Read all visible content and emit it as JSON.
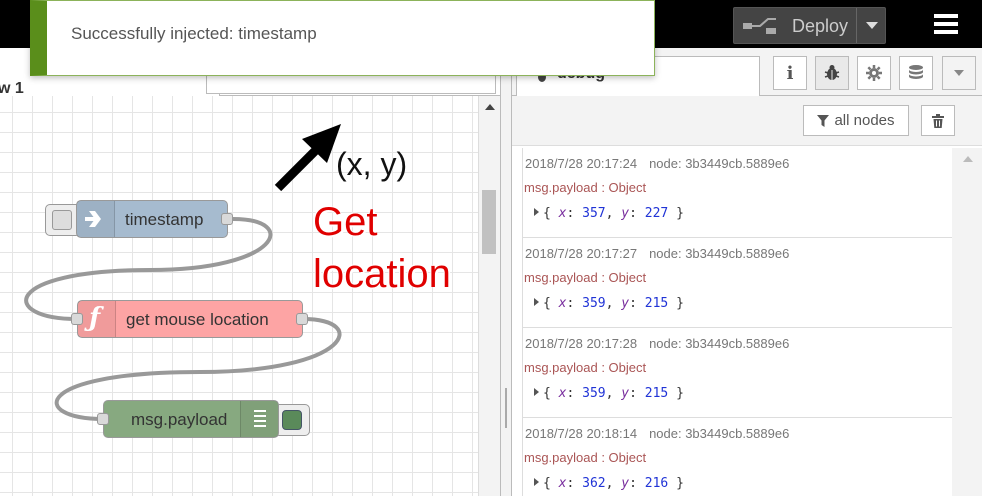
{
  "header": {
    "deploy_label": "Deploy"
  },
  "workspace": {
    "flow_tab_label": "w 1",
    "add_tab_symbol": "+"
  },
  "notification": {
    "text": "Successfully injected: timestamp"
  },
  "nodes": {
    "inject_label": "timestamp",
    "function_label": "get mouse location",
    "debug_label": "msg.payload",
    "function_icon": "ƒ"
  },
  "annotations": {
    "coord_text": "(x, y)",
    "red_line1": "Get",
    "red_line2": "location"
  },
  "sidebar": {
    "tab_label": "debug",
    "all_nodes_label": "all nodes",
    "tab_buttons": [
      "info-icon",
      "bug-icon",
      "gear-icon",
      "database-icon",
      "caret-down-icon"
    ],
    "messages": [
      {
        "time": "2018/7/28 20:17:24",
        "node": "node: 3b3449cb.5889e6",
        "topic": "msg.payload : Object",
        "x": "357",
        "y": "227"
      },
      {
        "time": "2018/7/28 20:17:27",
        "node": "node: 3b3449cb.5889e6",
        "topic": "msg.payload : Object",
        "x": "359",
        "y": "215"
      },
      {
        "time": "2018/7/28 20:17:28",
        "node": "node: 3b3449cb.5889e6",
        "topic": "msg.payload : Object",
        "x": "359",
        "y": "215"
      },
      {
        "time": "2018/7/28 20:18:14",
        "node": "node: 3b3449cb.5889e6",
        "topic": "msg.payload : Object",
        "x": "362",
        "y": "216"
      }
    ]
  },
  "colors": {
    "inject_node": "#a6bbcf",
    "function_node": "#fda4a4",
    "debug_node": "#87a980",
    "notify_accent": "#5a8e1b",
    "annotation_red": "#e00000"
  }
}
